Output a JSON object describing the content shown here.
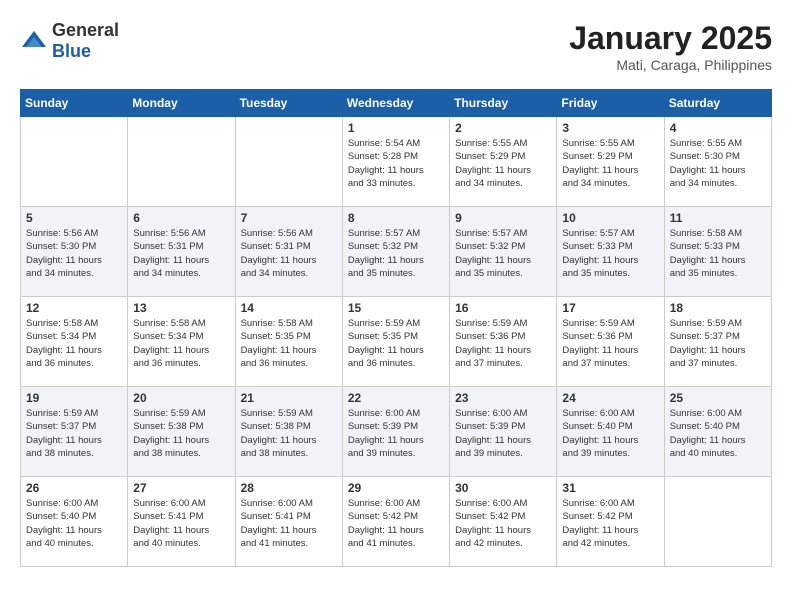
{
  "header": {
    "logo_general": "General",
    "logo_blue": "Blue",
    "month_year": "January 2025",
    "location": "Mati, Caraga, Philippines"
  },
  "weekdays": [
    "Sunday",
    "Monday",
    "Tuesday",
    "Wednesday",
    "Thursday",
    "Friday",
    "Saturday"
  ],
  "weeks": [
    [
      {
        "day": "",
        "info": ""
      },
      {
        "day": "",
        "info": ""
      },
      {
        "day": "",
        "info": ""
      },
      {
        "day": "1",
        "info": "Sunrise: 5:54 AM\nSunset: 5:28 PM\nDaylight: 11 hours\nand 33 minutes."
      },
      {
        "day": "2",
        "info": "Sunrise: 5:55 AM\nSunset: 5:29 PM\nDaylight: 11 hours\nand 34 minutes."
      },
      {
        "day": "3",
        "info": "Sunrise: 5:55 AM\nSunset: 5:29 PM\nDaylight: 11 hours\nand 34 minutes."
      },
      {
        "day": "4",
        "info": "Sunrise: 5:55 AM\nSunset: 5:30 PM\nDaylight: 11 hours\nand 34 minutes."
      }
    ],
    [
      {
        "day": "5",
        "info": "Sunrise: 5:56 AM\nSunset: 5:30 PM\nDaylight: 11 hours\nand 34 minutes."
      },
      {
        "day": "6",
        "info": "Sunrise: 5:56 AM\nSunset: 5:31 PM\nDaylight: 11 hours\nand 34 minutes."
      },
      {
        "day": "7",
        "info": "Sunrise: 5:56 AM\nSunset: 5:31 PM\nDaylight: 11 hours\nand 34 minutes."
      },
      {
        "day": "8",
        "info": "Sunrise: 5:57 AM\nSunset: 5:32 PM\nDaylight: 11 hours\nand 35 minutes."
      },
      {
        "day": "9",
        "info": "Sunrise: 5:57 AM\nSunset: 5:32 PM\nDaylight: 11 hours\nand 35 minutes."
      },
      {
        "day": "10",
        "info": "Sunrise: 5:57 AM\nSunset: 5:33 PM\nDaylight: 11 hours\nand 35 minutes."
      },
      {
        "day": "11",
        "info": "Sunrise: 5:58 AM\nSunset: 5:33 PM\nDaylight: 11 hours\nand 35 minutes."
      }
    ],
    [
      {
        "day": "12",
        "info": "Sunrise: 5:58 AM\nSunset: 5:34 PM\nDaylight: 11 hours\nand 36 minutes."
      },
      {
        "day": "13",
        "info": "Sunrise: 5:58 AM\nSunset: 5:34 PM\nDaylight: 11 hours\nand 36 minutes."
      },
      {
        "day": "14",
        "info": "Sunrise: 5:58 AM\nSunset: 5:35 PM\nDaylight: 11 hours\nand 36 minutes."
      },
      {
        "day": "15",
        "info": "Sunrise: 5:59 AM\nSunset: 5:35 PM\nDaylight: 11 hours\nand 36 minutes."
      },
      {
        "day": "16",
        "info": "Sunrise: 5:59 AM\nSunset: 5:36 PM\nDaylight: 11 hours\nand 37 minutes."
      },
      {
        "day": "17",
        "info": "Sunrise: 5:59 AM\nSunset: 5:36 PM\nDaylight: 11 hours\nand 37 minutes."
      },
      {
        "day": "18",
        "info": "Sunrise: 5:59 AM\nSunset: 5:37 PM\nDaylight: 11 hours\nand 37 minutes."
      }
    ],
    [
      {
        "day": "19",
        "info": "Sunrise: 5:59 AM\nSunset: 5:37 PM\nDaylight: 11 hours\nand 38 minutes."
      },
      {
        "day": "20",
        "info": "Sunrise: 5:59 AM\nSunset: 5:38 PM\nDaylight: 11 hours\nand 38 minutes."
      },
      {
        "day": "21",
        "info": "Sunrise: 5:59 AM\nSunset: 5:38 PM\nDaylight: 11 hours\nand 38 minutes."
      },
      {
        "day": "22",
        "info": "Sunrise: 6:00 AM\nSunset: 5:39 PM\nDaylight: 11 hours\nand 39 minutes."
      },
      {
        "day": "23",
        "info": "Sunrise: 6:00 AM\nSunset: 5:39 PM\nDaylight: 11 hours\nand 39 minutes."
      },
      {
        "day": "24",
        "info": "Sunrise: 6:00 AM\nSunset: 5:40 PM\nDaylight: 11 hours\nand 39 minutes."
      },
      {
        "day": "25",
        "info": "Sunrise: 6:00 AM\nSunset: 5:40 PM\nDaylight: 11 hours\nand 40 minutes."
      }
    ],
    [
      {
        "day": "26",
        "info": "Sunrise: 6:00 AM\nSunset: 5:40 PM\nDaylight: 11 hours\nand 40 minutes."
      },
      {
        "day": "27",
        "info": "Sunrise: 6:00 AM\nSunset: 5:41 PM\nDaylight: 11 hours\nand 40 minutes."
      },
      {
        "day": "28",
        "info": "Sunrise: 6:00 AM\nSunset: 5:41 PM\nDaylight: 11 hours\nand 41 minutes."
      },
      {
        "day": "29",
        "info": "Sunrise: 6:00 AM\nSunset: 5:42 PM\nDaylight: 11 hours\nand 41 minutes."
      },
      {
        "day": "30",
        "info": "Sunrise: 6:00 AM\nSunset: 5:42 PM\nDaylight: 11 hours\nand 42 minutes."
      },
      {
        "day": "31",
        "info": "Sunrise: 6:00 AM\nSunset: 5:42 PM\nDaylight: 11 hours\nand 42 minutes."
      },
      {
        "day": "",
        "info": ""
      }
    ]
  ]
}
